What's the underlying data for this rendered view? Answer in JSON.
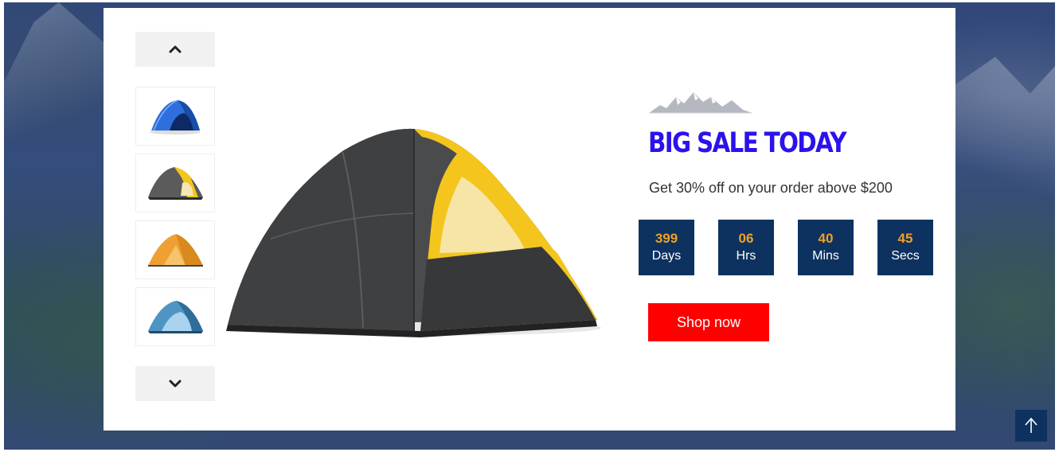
{
  "slider": {
    "up_icon": "chevron-up-icon",
    "down_icon": "chevron-down-icon",
    "thumbnails": [
      {
        "name": "blue-tent",
        "color": "#2f6fdc"
      },
      {
        "name": "gray-yellow-tent",
        "color": "#5b5b5b"
      },
      {
        "name": "orange-tent",
        "color": "#f0a033"
      },
      {
        "name": "light-blue-tent",
        "color": "#4f95c4"
      }
    ],
    "main_image": {
      "name": "gray-yellow-tent",
      "body_color": "#4a4b4d",
      "accent_color": "#f4c51c"
    }
  },
  "promo": {
    "title": "BIG SALE TODAY",
    "subtitle": "Get 30% off on your order above $200",
    "countdown": [
      {
        "value": "399",
        "label": "Days"
      },
      {
        "value": "06",
        "label": "Hrs"
      },
      {
        "value": "40",
        "label": "Mins"
      },
      {
        "value": "45",
        "label": "Secs"
      }
    ],
    "button_label": "Shop now"
  },
  "colors": {
    "title": "#2b12ec",
    "countdown_bg": "#0d3260",
    "countdown_number": "#f2a025",
    "button": "#ff0000"
  },
  "back_to_top_icon": "arrow-up-icon"
}
